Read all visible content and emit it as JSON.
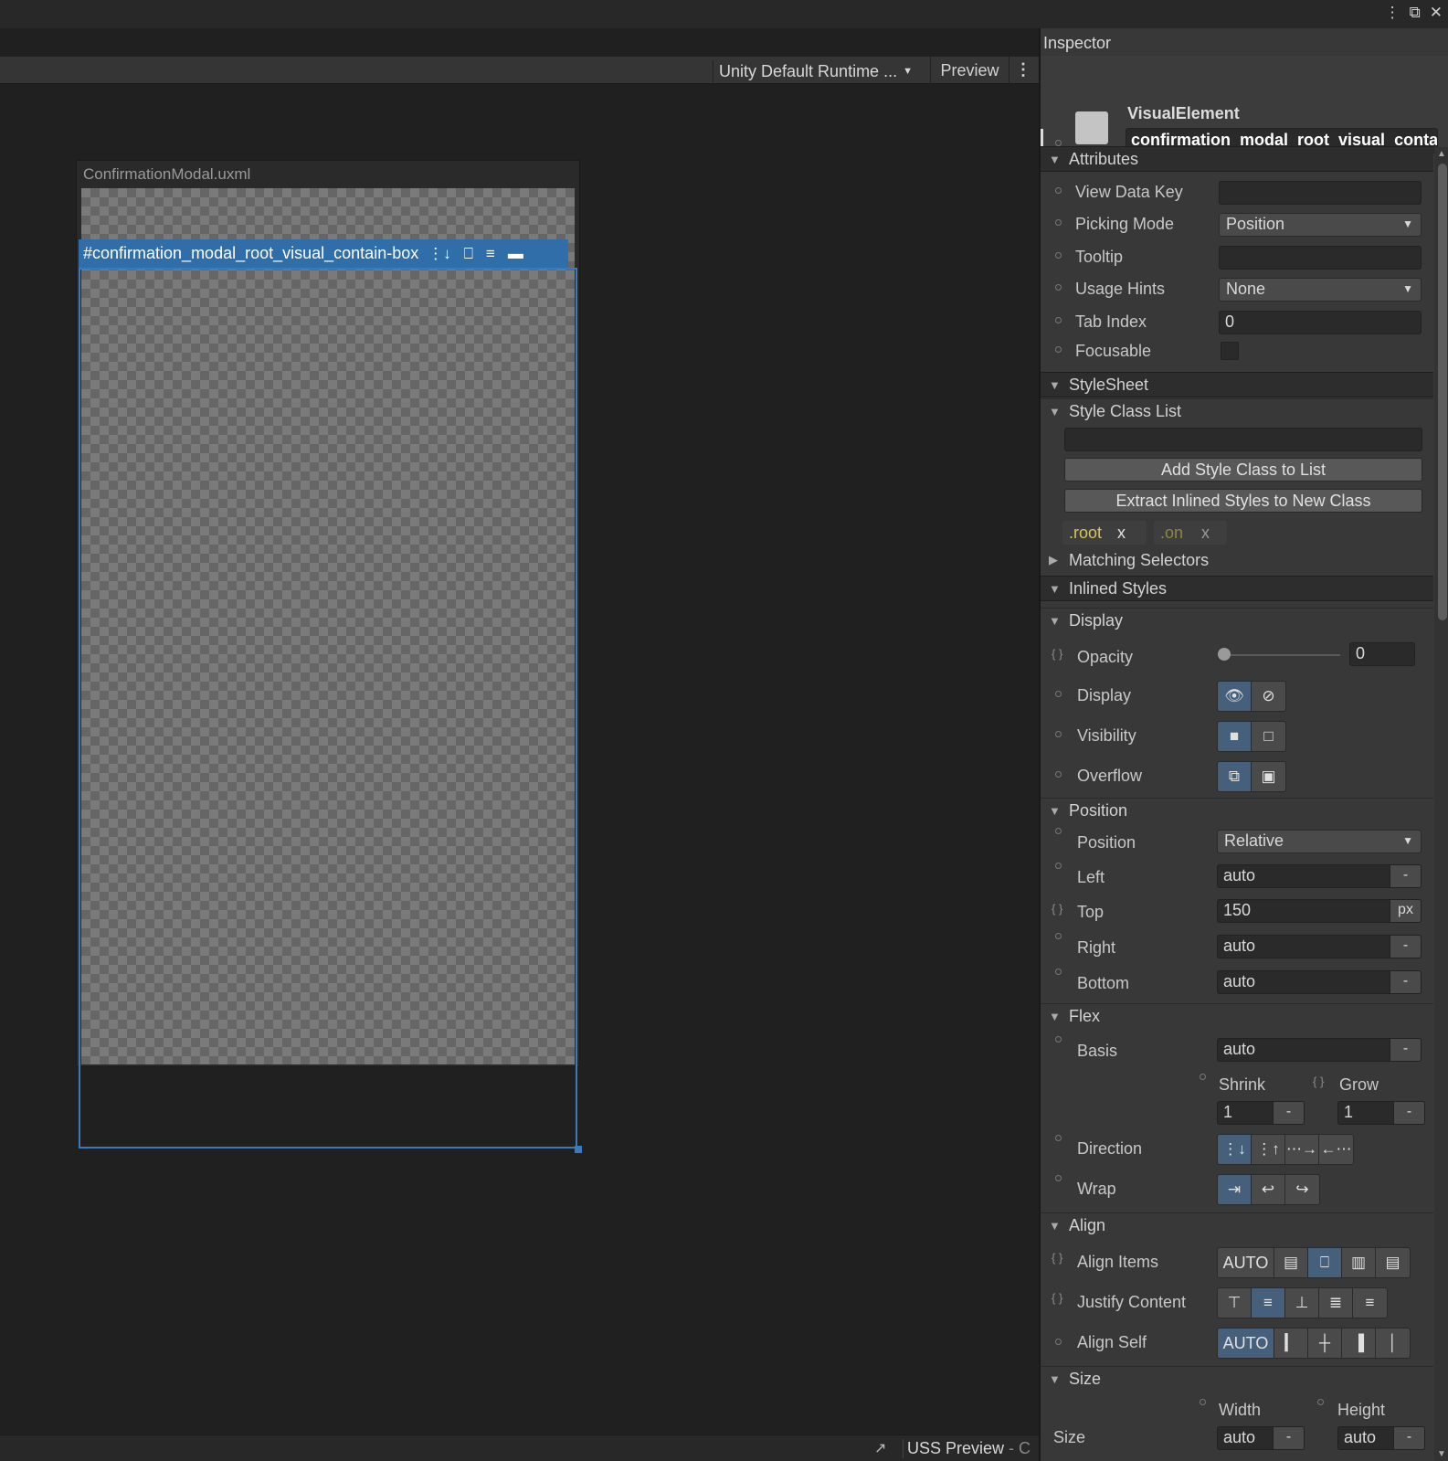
{
  "window": {
    "icons": [
      "kebab-icon",
      "restore-icon",
      "close-icon"
    ]
  },
  "viewport": {
    "runtime_theme": "Unity Default Runtime ...",
    "preview_label": "Preview",
    "canvas_title": "ConfirmationModal.uxml",
    "selected_tag": "#confirmation_modal_root_visual_contain-box",
    "status": {
      "uss_preview": "USS Preview",
      "trailing": "- C"
    }
  },
  "inspector": {
    "title": "Inspector",
    "element_type": "VisualElement",
    "element_name": "confirmation_modal_root_visual_contai",
    "attributes": {
      "header": "Attributes",
      "view_data_key_label": "View Data Key",
      "view_data_key": "",
      "picking_mode_label": "Picking Mode",
      "picking_mode": "Position",
      "tooltip_label": "Tooltip",
      "tooltip": "",
      "usage_hints_label": "Usage Hints",
      "usage_hints": "None",
      "tab_index_label": "Tab Index",
      "tab_index": "0",
      "focusable_label": "Focusable",
      "focusable": false
    },
    "stylesheet": {
      "header": "StyleSheet",
      "style_class_list": "Style Class List",
      "class_input": "",
      "add_button": "Add Style Class to List",
      "extract_button": "Extract Inlined Styles to New Class",
      "classes": [
        {
          "name": ".root",
          "remove": "x"
        },
        {
          "name": ".on",
          "remove": "x"
        }
      ],
      "matching_selectors": "Matching Selectors"
    },
    "inlined": {
      "header": "Inlined Styles",
      "display": {
        "header": "Display",
        "opacity_label": "Opacity",
        "opacity": "0",
        "opacity_fraction": 0,
        "display_label": "Display",
        "visibility_label": "Visibility",
        "overflow_label": "Overflow"
      },
      "position": {
        "header": "Position",
        "position_label": "Position",
        "position": "Relative",
        "left_label": "Left",
        "left": "auto",
        "left_unit": "-",
        "top_label": "Top",
        "top": "150",
        "top_unit": "px",
        "right_label": "Right",
        "right": "auto",
        "right_unit": "-",
        "bottom_label": "Bottom",
        "bottom": "auto",
        "bottom_unit": "-"
      },
      "flex": {
        "header": "Flex",
        "basis_label": "Basis",
        "basis": "auto",
        "basis_unit": "-",
        "shrink_label": "Shrink",
        "shrink": "1",
        "shrink_unit": "-",
        "grow_label": "Grow",
        "grow": "1",
        "grow_unit": "-",
        "direction_label": "Direction",
        "wrap_label": "Wrap"
      },
      "align": {
        "header": "Align",
        "align_items_label": "Align Items",
        "align_items_auto": "AUTO",
        "justify_label": "Justify Content",
        "align_self_label": "Align Self",
        "align_self_auto": "AUTO"
      },
      "size": {
        "header": "Size",
        "size_label": "Size",
        "width_label": "Width",
        "width": "auto",
        "width_unit": "-",
        "height_label": "Height",
        "height": "auto",
        "height_unit": "-"
      }
    }
  },
  "colors": {
    "accent": "#3a79bb",
    "selection_tag": "#2f6ea8",
    "toggle_on": "#46607c",
    "class_text": "#d8c65a"
  }
}
